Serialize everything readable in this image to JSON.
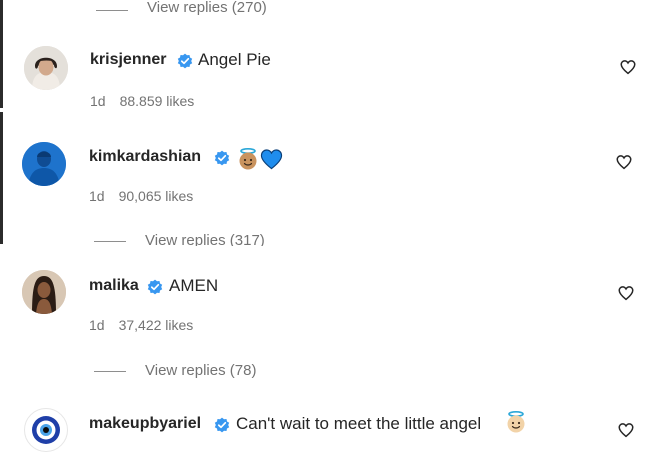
{
  "comments": [
    {
      "username": "krisjenner",
      "text": "Angel Pie",
      "age": "1d",
      "likes": "88.859 likes",
      "view_replies_above": "View replies (270)"
    },
    {
      "username": "kimkardashian",
      "text": "",
      "emojis": [
        "angel-face-emoji",
        "blue-heart-emoji"
      ],
      "age": "1d",
      "likes": "90,065 likes",
      "view_replies": "View replies (317)"
    },
    {
      "username": "malika",
      "text": "AMEN",
      "age": "1d",
      "likes": "37,422 likes",
      "view_replies": "View replies (78)"
    },
    {
      "username": "makeupbyariel",
      "text": "Can't wait to meet the little angel",
      "emojis": [
        "angel-face-emoji"
      ]
    }
  ],
  "colors": {
    "verified": "#3897f0",
    "text": "#262626",
    "muted": "#737373"
  },
  "icons": [
    "verified-badge-icon",
    "heart-icon"
  ]
}
